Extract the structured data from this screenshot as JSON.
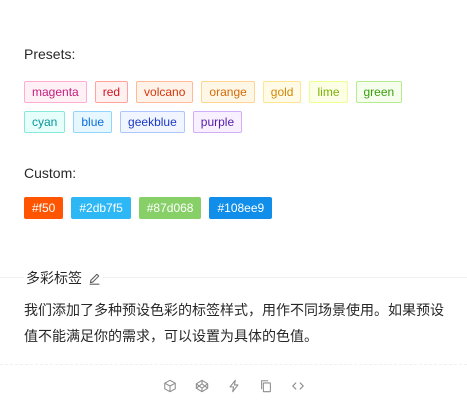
{
  "presets": {
    "title": "Presets:",
    "tags": [
      {
        "label": "magenta",
        "color": "#c41d7f",
        "bg": "#fff0f6",
        "border": "#ffadd2"
      },
      {
        "label": "red",
        "color": "#cf1322",
        "bg": "#fff1f0",
        "border": "#ffa39e"
      },
      {
        "label": "volcano",
        "color": "#d4380d",
        "bg": "#fff2e8",
        "border": "#ffbb96"
      },
      {
        "label": "orange",
        "color": "#d46b08",
        "bg": "#fff7e6",
        "border": "#ffd591"
      },
      {
        "label": "gold",
        "color": "#d48806",
        "bg": "#fffbe6",
        "border": "#ffe58f"
      },
      {
        "label": "lime",
        "color": "#7cb305",
        "bg": "#fcffe6",
        "border": "#eaff8f"
      },
      {
        "label": "green",
        "color": "#389e0d",
        "bg": "#f6ffed",
        "border": "#b7eb8f"
      },
      {
        "label": "cyan",
        "color": "#08979c",
        "bg": "#e6fffb",
        "border": "#87e8de"
      },
      {
        "label": "blue",
        "color": "#096dd9",
        "bg": "#e6f7ff",
        "border": "#91d5ff"
      },
      {
        "label": "geekblue",
        "color": "#1d39c4",
        "bg": "#f0f5ff",
        "border": "#adc6ff"
      },
      {
        "label": "purple",
        "color": "#531dab",
        "bg": "#f9f0ff",
        "border": "#d3adf7"
      }
    ]
  },
  "custom": {
    "title": "Custom:",
    "tags": [
      {
        "label": "#f50",
        "bg": "#ff5500"
      },
      {
        "label": "#2db7f5",
        "bg": "#2db7f5"
      },
      {
        "label": "#87d068",
        "bg": "#87d068"
      },
      {
        "label": "#108ee9",
        "bg": "#108ee9"
      }
    ]
  },
  "meta": {
    "title": "多彩标签",
    "description": "我们添加了多种预设色彩的标签样式，用作不同场景使用。如果预设值不能满足你的需求，可以设置为具体的色值。"
  },
  "actions": [
    {
      "icon": "codesandbox-icon"
    },
    {
      "icon": "codepen-icon"
    },
    {
      "icon": "thunderbolt-icon"
    },
    {
      "icon": "copy-icon"
    },
    {
      "icon": "code-expand-icon"
    }
  ],
  "colors": {
    "divider": "#f0f0f0",
    "action_icon": "#8c8c8c"
  }
}
